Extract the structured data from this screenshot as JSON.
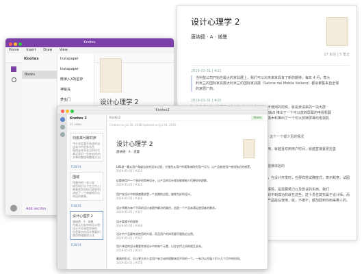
{
  "card": {
    "title": "设计心理学 2",
    "author": "唐纳德 · A · 诺曼",
    "stats": "17 标注 | 5 笔记",
    "entries": [
      {
        "date": "2019-03-31 | #21",
        "lines": [
          "当利益公司开始在最大的家具展上，我们可以对未来家具有了新的期待。每年 4 月，意大",
          "利米兰的国际家具展大利米兰的国际家具展（Salone del Mobile Italiano）都会聚集来自全球",
          "的家居厂商。"
        ]
      },
      {
        "date": "2019-03-31 | #25",
        "lines": [
          "当我们在做一件事情时会出错，犯这么大物件，不使用的时候，就是亲请来的一块大屏",
          "在没有使用时是一块大屏幕，需要时可以投放。B&O 推出了一个可以放转屏幕的电视机器",
          "某些需要的时候，根据家装的可以方便地移来转换木料推出了一个可以放转屏幕的电视机"
        ]
      },
      {
        "date": "2019-03-31 | #29",
        "lines": [
          "在你用的时候，它能提供你想要的东西的时候 — 这个一个很少见的情况"
        ]
      },
      {
        "date": "",
        "lines": [
          "为发展改善还是增加产品并不，就好的产品可以用，就越喜欢用用户时间，就越直接置更完善"
        ]
      },
      {
        "date": "",
        "lines": [
          "设计的情绪",
          "消费的心理满足：方式等价的产品好的地方，并能够体验的"
        ]
      },
      {
        "date": "",
        "lines": [
          "在这产品关系的人的理想：消费者并不考虑产品，在设计开发时，在那样尝试确度式，表示断意，试图解决问题，自助支持"
        ]
      },
      {
        "date": "",
        "lines": [
          "我们要在的，是和我们自己的家园那样和有对的事情，是需要努力以及尝试的东西，我们",
          "上产品多家户来做的人的事来，因为做很多，而对不到成功的就在这些，这个责任其实属于设计师，而不是机器。四",
          "都是对手于某用户来了一种所认好来的，两些和产品能在使用，就，不被不，都加回到你用来推人的。"
        ]
      }
    ]
  },
  "purple": {
    "app_title": "Knotes",
    "menu": [
      "Home",
      "Insert",
      "Draw",
      "View"
    ],
    "notebook": "Knotes",
    "notebook_selected": "Books",
    "add_section": "Add section",
    "sections": [
      "Instapaper",
      "Instapaper",
      "微读入X的星存",
      "神秘岛",
      "梦虫门"
    ],
    "page_title": "设计心理学 2"
  },
  "light": {
    "app_title": "Knotes2",
    "notebook": "Knotes 2",
    "note_count": "21 notes",
    "breadcrumb": "Knotes2",
    "share": "Share",
    "subline": "Created on Jul 28, 2019     Updated on Jul 28, 2019",
    "cards": [
      {
        "title": "归去来兮辞并序",
        "lines": [
          "今天决定要开始读的这本书",
          "这本书中很多东西",
          "值得这样多花点时间写下来",
          "来记录对一些有名的诗词或者",
          "文章的整理和整理方法是"
        ],
        "date": "7/28/19"
      },
      {
        "title": "围城",
        "lines": [
          "钱锺书的一本小说",
          "描写知识分子在工作上的生活",
          "故事发生在抗日战争初期",
          "讲述了一个跨越知识分子",
          "命运的故事。"
        ],
        "date": "7/28/19"
      },
      {
        "title": "设计心理学 2",
        "lines": [
          "唐纳德 · A · 诺曼",
          "作者认为复杂的设计是有必要的",
          "设计不应该是简单的",
          "但是复杂的设计需要好的",
          "使用和理解的方法"
        ],
        "date": "7/28/19"
      }
    ],
    "doc_title": "设计心理学 2",
    "doc_author": "唐纳德 · A · 诺曼",
    "entries": [
      {
        "text": "UID说一番从用户角度出发的设计过程，它強烈从用户的视角来研究用户行为，让产品能使用户感觉贴近的感受。",
        "date": "2019-05-05 | #215"
      },
      {
        "text": "这重使用户一个多好的简单设计，让产品的设计理念能够被人们更好的理解。",
        "date": "2019-05-05 | #321"
      },
      {
        "text": "用户在设计中的情感需求是一个长期的过程，被称为好的设计。",
        "date": "2019-05-05 | #340"
      },
      {
        "text": "设计师需为每个不同的设计者提供解决的路径，创造一个产品来满足使用者的需求。",
        "date": "2019-05-05 | #347"
      },
      {
        "text": "设计要遵守的规则",
        "date": "2019-05-05 | #408"
      },
      {
        "text": "设计中产品要考虑使用的外观，而且用户的体验要尽量贴近自然。",
        "date": "2019-05-05 | #507"
      },
      {
        "text": "用户体验的设计需要考虑设计中的每个元素，以及它们之间的相互关系。",
        "date": "2019-05-05 | #541"
      },
      {
        "text": "最高的形式，它以更大的人会用户来主动的理解体验不同的一个。一有可以开展人们十几个月中的时间。",
        "date": "2019-05-05 | #578"
      }
    ]
  },
  "colors": {
    "purple": "#7b3fa8",
    "accent": "#5a86c4"
  }
}
